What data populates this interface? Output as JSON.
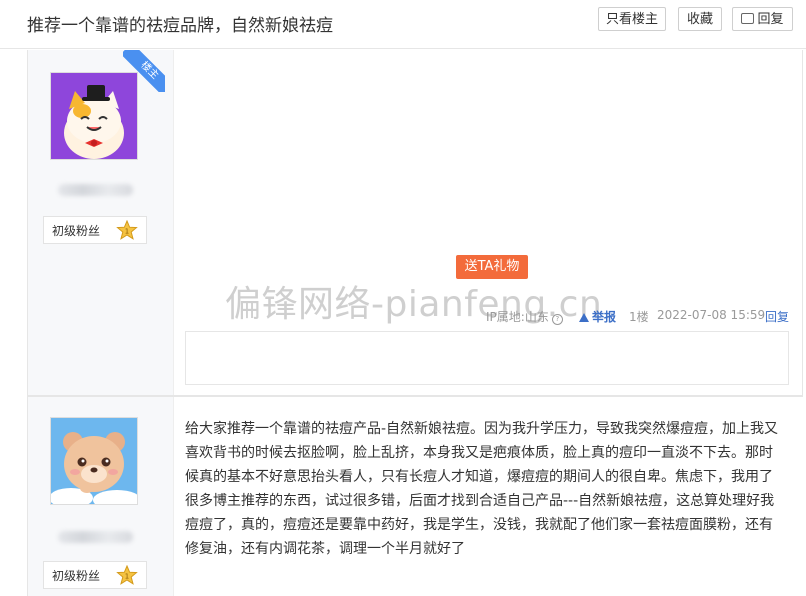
{
  "header": {
    "title": "推荐一个靠谱的祛痘品牌，自然新娘祛痘",
    "buttons": {
      "only_owner": "只看楼主",
      "favorite": "收藏",
      "reply": "回复"
    }
  },
  "posts": [
    {
      "owner_tag": "楼主",
      "level_label": "初级粉丝",
      "gift_button": "送TA礼物",
      "watermark": "偏锋网络-pianfeng.cn",
      "ip_label": "IP属地:山东",
      "ip_help": "?",
      "report": "举报",
      "floor": "1楼",
      "time": "2022-07-08 15:59",
      "reply": "回复"
    },
    {
      "level_label": "初级粉丝",
      "content": "给大家推荐一个靠谱的祛痘产品-自然新娘祛痘。因为我升学压力，导致我突然爆痘痘，加上我又喜欢背书的时候去抠脸啊，脸上乱挤，本身我又是疤痕体质，脸上真的痘印一直淡不下去。那时候真的基本不好意思抬头看人，只有长痘人才知道，爆痘痘的期间人的很自卑。焦虑下，我用了很多博主推荐的东西，试过很多错，后面才找到合适自己产品---自然新娘祛痘，这总算处理好我痘痘了，真的，痘痘还是要靠中药好，我是学生，没钱，我就配了他们家一套祛痘面膜粉，还有修复油，还有内调花茶，调理一个半月就好了"
    }
  ],
  "colors": {
    "accent_blue": "#3c6fc7",
    "gift_orange": "#f36b3b",
    "owner_tag_blue": "#4a90f0"
  }
}
